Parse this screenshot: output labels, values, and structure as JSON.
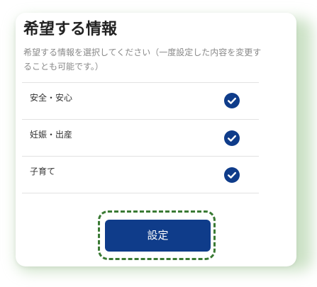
{
  "panel": {
    "title": "希望する情報",
    "description": "希望する情報を選択してください（一度設定した内容を変更することも可能です。）"
  },
  "options": [
    {
      "label": "安全・安心",
      "checked": true
    },
    {
      "label": "妊娠・出産",
      "checked": true
    },
    {
      "label": "子育て",
      "checked": true
    }
  ],
  "submit": {
    "label": "設定"
  },
  "colors": {
    "accent": "#0f3c8a",
    "focus_ring": "#3a7a34",
    "check_fill": "#0f3c8a"
  }
}
